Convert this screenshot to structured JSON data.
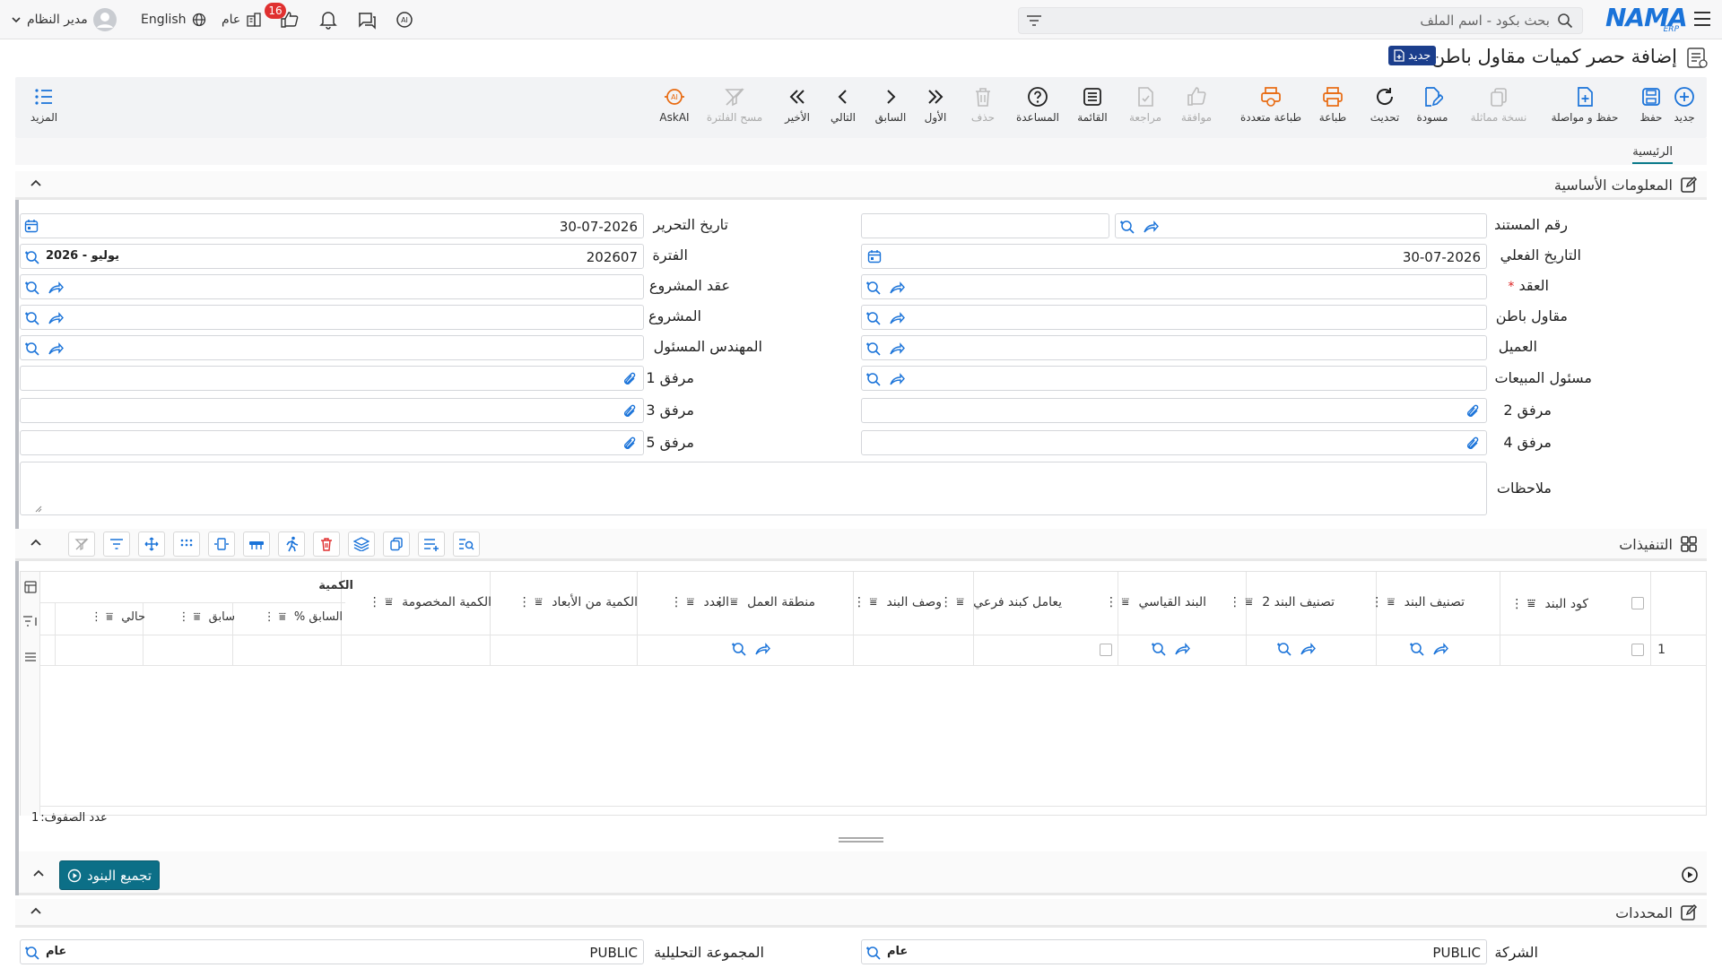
{
  "topbar": {
    "search_placeholder": "بحث بكود - اسم الملف",
    "user_label": "مدير النظام",
    "language_label": "English",
    "scope_label": "عام",
    "notifications_count": "16"
  },
  "logo": {
    "text": "NAMA",
    "sub": "ERP"
  },
  "page": {
    "title": "إضافة حصر كميات مقاول باطن",
    "status_badge": "جديد"
  },
  "toolbar": {
    "new": "جديد",
    "save": "حفظ",
    "save_continue": "حفظ و مواصلة",
    "copy_similar": "نسخة مماثلة",
    "draft": "مسودة",
    "refresh": "تحديث",
    "print": "طباعة",
    "multi_print": "طباعة متعددة",
    "approve": "موافقة",
    "review": "مراجعة",
    "list": "القائمة",
    "help": "المساعدة",
    "delete": "حذف",
    "first": "الأول",
    "previous": "السابق",
    "next": "التالي",
    "last": "الأخير",
    "clear_filter": "مسح الفلترة",
    "askai": "AskAI",
    "more": "المزيد"
  },
  "tabs": {
    "main": "الرئيسية"
  },
  "basic_section": {
    "title": "المعلومات الأساسية",
    "fields": {
      "doc_number_label": "رقم المستند",
      "doc_number_value": "",
      "edit_date_label": "تاريخ التحرير",
      "edit_date_value": "30-07-2026",
      "actual_date_label": "التاريخ الفعلي",
      "actual_date_value": "30-07-2026",
      "period_label": "الفترة",
      "period_value": "202607",
      "period_tag": "2026 - يوليو",
      "contract_label": "العقد",
      "contract_required": "*",
      "project_contract_label": "عقد المشروع",
      "subcontractor_label": "مقاول باطن",
      "project_label": "المشروع",
      "customer_label": "العميل",
      "engineer_label": "المهندس المسئول",
      "sales_label": "مسئول المبيعات",
      "attach1_label": "مرفق 1",
      "attach2_label": "مرفق 2",
      "attach3_label": "مرفق 3",
      "attach4_label": "مرفق 4",
      "attach5_label": "مرفق 5",
      "notes_label": "ملاحظات"
    }
  },
  "executions": {
    "title": "التنفيذات",
    "columns": {
      "item_code": "كود البند",
      "item_class": "تصنيف البند",
      "item_class2": "تصنيف البند 2",
      "standard_item": "البند القياسي",
      "treat_sub": "يعامل كبند فرعي",
      "item_desc": "وصف البند",
      "work_area": "منطقة العمل",
      "count": "العدد",
      "qty_dims": "الكمية من الأبعاد",
      "qty_deducted": "الكمية المخصومة",
      "quantity_group": "الكمية",
      "prev_pct": "السابق %",
      "prev": "سابق",
      "current": "حالي"
    },
    "rows": [
      {
        "num": "1"
      }
    ],
    "row_count_label": "عدد الصفوف:",
    "row_count": "1"
  },
  "group_button": "تجميع البنود",
  "determinants": {
    "title": "المحددات",
    "company_label": "الشركة",
    "company_value": "PUBLIC",
    "company_tag": "عام",
    "analytic_label": "المجموعة التحليلية",
    "analytic_value": "PUBLIC",
    "analytic_tag": "عام"
  },
  "colors": {
    "accent": "#1a73d9",
    "primary_button": "#0c6f87",
    "badge": "#1b3e8c",
    "danger": "#e03030"
  }
}
